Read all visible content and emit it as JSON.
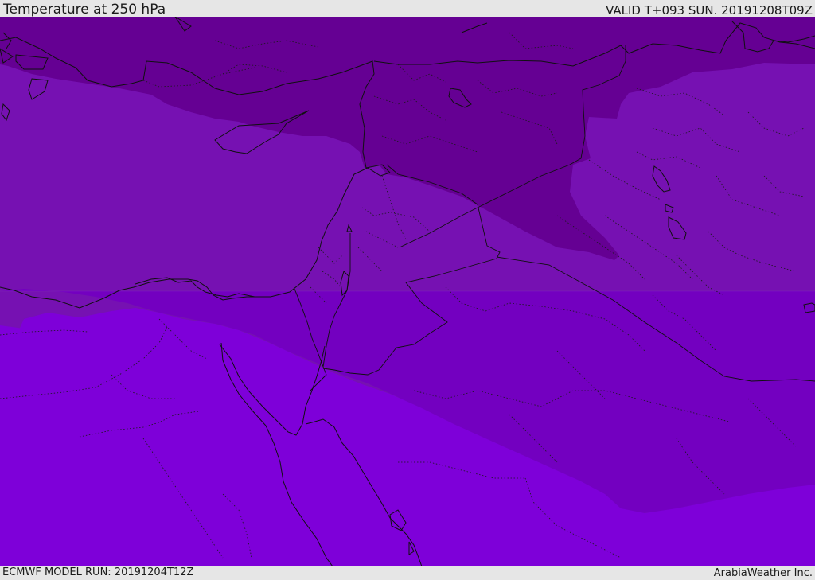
{
  "header": {
    "title": "Temperature at 250 hPa",
    "valid_time": "VALID T+093 SUN. 20191208T09Z"
  },
  "footer": {
    "model_run": "ECMWF MODEL RUN: 20191204T12Z",
    "credit": "ArabiaWeather Inc."
  },
  "map": {
    "colors": {
      "band_coldest": "#650093",
      "band_cold": "#7611b2",
      "band_mid": "#7300c0",
      "band_warm": "#7e00d9",
      "line": "#101010"
    }
  }
}
